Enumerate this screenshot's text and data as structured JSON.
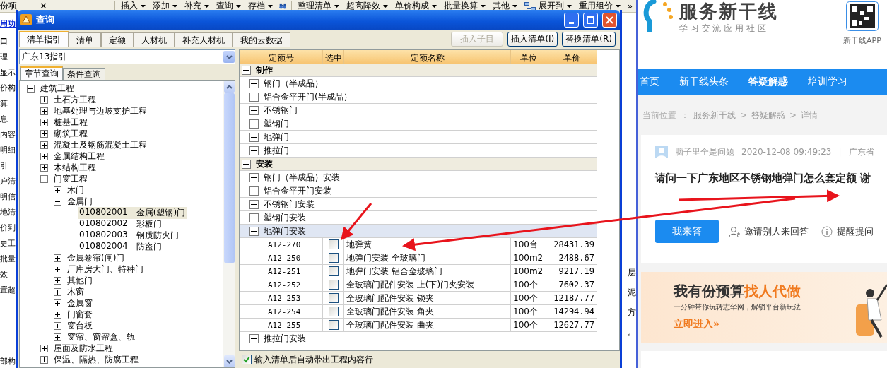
{
  "toolbar": {
    "left_label": "份项",
    "close_glyph": "✕",
    "menus": [
      {
        "kind": "menu",
        "label": "插入"
      },
      {
        "kind": "menu",
        "label": "添加"
      },
      {
        "kind": "menu",
        "label": "补充"
      },
      {
        "kind": "menu",
        "label": "查询"
      },
      {
        "kind": "menu",
        "label": "存档"
      },
      {
        "kind": "binoculars"
      },
      {
        "kind": "menu",
        "label": "整理清单"
      },
      {
        "kind": "menu",
        "label": "超高降效"
      },
      {
        "kind": "menu",
        "label": "单价构成"
      },
      {
        "kind": "menu",
        "label": "批量换算"
      },
      {
        "kind": "menu",
        "label": "其他"
      },
      {
        "kind": "tree_menu",
        "label": "展开到"
      },
      {
        "kind": "menu",
        "label": "重用组价"
      }
    ],
    "overflow_glyph": "»"
  },
  "side_strip": {
    "link": "用功",
    "items": [
      "口",
      "理",
      "显示",
      "价构",
      "算",
      "息",
      "内容",
      "明细",
      "引",
      "户清",
      "明信",
      "地清",
      "价到",
      "史工",
      "批量",
      "效",
      "置超"
    ],
    "bottom": "部构"
  },
  "right_strip": [
    "层",
    "泥",
    "方",
    "。"
  ],
  "dialog": {
    "title": "查询",
    "tabs": [
      {
        "label": "清单指引",
        "selected": true
      },
      {
        "label": "清单",
        "selected": false
      },
      {
        "label": "定额",
        "selected": false
      },
      {
        "label": "人材机",
        "selected": false
      },
      {
        "label": "补充人材机",
        "selected": false
      },
      {
        "label": "我的云数据",
        "selected": false
      }
    ],
    "actions": [
      {
        "label": "插入子目",
        "disabled": true
      },
      {
        "label": "插入清单(I)",
        "disabled": false
      },
      {
        "label": "替换清单(R)",
        "disabled": false
      }
    ],
    "library": {
      "value": "广东13指引"
    },
    "query_tabs": [
      {
        "label": "章节查询",
        "selected": true
      },
      {
        "label": "条件查询",
        "selected": false
      }
    ],
    "tree": [
      {
        "label": "建筑工程",
        "expanded": true,
        "children": [
          {
            "label": "土石方工程",
            "expanded": false
          },
          {
            "label": "地基处理与边坡支护工程",
            "expanded": false
          },
          {
            "label": "桩基工程",
            "expanded": false
          },
          {
            "label": "砌筑工程",
            "expanded": false
          },
          {
            "label": "混凝土及钢筋混凝土工程",
            "expanded": false
          },
          {
            "label": "金属结构工程",
            "expanded": false
          },
          {
            "label": "木结构工程",
            "expanded": false
          },
          {
            "label": "门窗工程",
            "expanded": true,
            "children": [
              {
                "label": "木门",
                "expanded": false
              },
              {
                "label": "金属门",
                "expanded": true,
                "children": [
                  {
                    "code": "010802001",
                    "label": "金属(塑钢)门",
                    "selected": true
                  },
                  {
                    "code": "010802002",
                    "label": "彩板门",
                    "selected": false
                  },
                  {
                    "code": "010802003",
                    "label": "钢质防火门",
                    "selected": false
                  },
                  {
                    "code": "010802004",
                    "label": "防盗门",
                    "selected": false
                  }
                ]
              },
              {
                "label": "金属卷帘(闸)门",
                "expanded": false
              },
              {
                "label": "厂库房大门、特种门",
                "expanded": false
              },
              {
                "label": "其他门",
                "expanded": false
              },
              {
                "label": "木窗",
                "expanded": false
              },
              {
                "label": "金属窗",
                "expanded": false
              },
              {
                "label": "门窗套",
                "expanded": false
              },
              {
                "label": "窗台板",
                "expanded": false
              },
              {
                "label": "窗帘、窗帘盒、轨",
                "expanded": false
              }
            ]
          },
          {
            "label": "屋面及防水工程",
            "expanded": false
          },
          {
            "label": "保温、隔热、防腐工程",
            "expanded": false
          }
        ]
      }
    ],
    "table": {
      "columns": [
        "定额号",
        "选中",
        "定额名称",
        "单位",
        "单价"
      ],
      "groups": [
        {
          "title": "制作",
          "expanded": true,
          "children": [
            {
              "title": "钢门（半成品）",
              "expanded": false,
              "selected": false
            },
            {
              "title": "铝合金平开门(半成品）",
              "expanded": false,
              "selected": false
            },
            {
              "title": "不锈钢门",
              "expanded": false,
              "selected": false
            },
            {
              "title": "塑钢门",
              "expanded": false,
              "selected": false
            },
            {
              "title": "地弹门",
              "expanded": false,
              "selected": false
            },
            {
              "title": "推拉门",
              "expanded": false,
              "selected": false
            }
          ]
        },
        {
          "title": "安装",
          "expanded": true,
          "children": [
            {
              "title": "钢门（半成品）安装",
              "expanded": false,
              "selected": false
            },
            {
              "title": "铝合金平开门安装",
              "expanded": false,
              "selected": false
            },
            {
              "title": "不锈钢门安装",
              "expanded": false,
              "selected": false
            },
            {
              "title": "塑钢门安装",
              "expanded": false,
              "selected": false
            },
            {
              "title": "地弹门安装",
              "expanded": true,
              "selected": true,
              "items": [
                {
                  "code": "A12-270",
                  "checked": false,
                  "name": "地弹簧",
                  "unit": "100台",
                  "price": "28431.39"
                },
                {
                  "code": "A12-250",
                  "checked": false,
                  "name": "地弹门安装 全玻璃门",
                  "unit": "100m2",
                  "price": "2488.67"
                },
                {
                  "code": "A12-251",
                  "checked": false,
                  "name": "地弹门安装 铝合金玻璃门",
                  "unit": "100m2",
                  "price": "9217.19"
                },
                {
                  "code": "A12-252",
                  "checked": false,
                  "name": "全玻璃门配件安装 上(下)门夹安装",
                  "unit": "100个",
                  "price": "7602.37"
                },
                {
                  "code": "A12-253",
                  "checked": false,
                  "name": "全玻璃门配件安装 锁夹",
                  "unit": "100个",
                  "price": "12187.77"
                },
                {
                  "code": "A12-254",
                  "checked": false,
                  "name": "全玻璃门配件安装 角夹",
                  "unit": "100个",
                  "price": "14294.94"
                },
                {
                  "code": "A12-255",
                  "checked": false,
                  "name": "全玻璃门配件安装 曲夹",
                  "unit": "100个",
                  "price": "12627.77"
                }
              ]
            },
            {
              "title": "推拉门安装",
              "expanded": false,
              "selected": false
            }
          ]
        }
      ]
    },
    "auto_option": {
      "label": "输入清单后自动带出工程内容行",
      "checked": true
    }
  },
  "web": {
    "logo": {
      "name": "服务新干线",
      "tagline": "学 习 交 流 应 用 社 区"
    },
    "app": {
      "label": "新干线APP"
    },
    "nav": [
      {
        "label": "首页",
        "selected": false
      },
      {
        "label": "新干线头条",
        "selected": false
      },
      {
        "label": "答疑解惑",
        "selected": true
      },
      {
        "label": "培训学习",
        "selected": false
      }
    ],
    "breadcrumb": [
      {
        "kind": "label",
        "text": "当前位置"
      },
      {
        "kind": "sep",
        "text": "："
      },
      {
        "kind": "link",
        "text": "服务新干线"
      },
      {
        "kind": "sep",
        "text": ">"
      },
      {
        "kind": "link",
        "text": "答疑解惑"
      },
      {
        "kind": "sep",
        "text": ">"
      },
      {
        "kind": "link",
        "text": "详情"
      }
    ],
    "question": {
      "author": "脑子里全是问题",
      "time": "2020-12-08 09:49:23",
      "divider": "|",
      "region": "广东省",
      "title": "请问一下广东地区不锈钢地弹门怎么套定额 谢"
    },
    "answer_button": "我来答",
    "invite": "邀请别人来回答",
    "remind": "提醒提问",
    "banner": {
      "headline": "我有份预算",
      "highlight": "找人代做",
      "subtitle": "一分钟带你玩转志华网，解锁平台新玩法",
      "cta": "立即进入»"
    }
  }
}
